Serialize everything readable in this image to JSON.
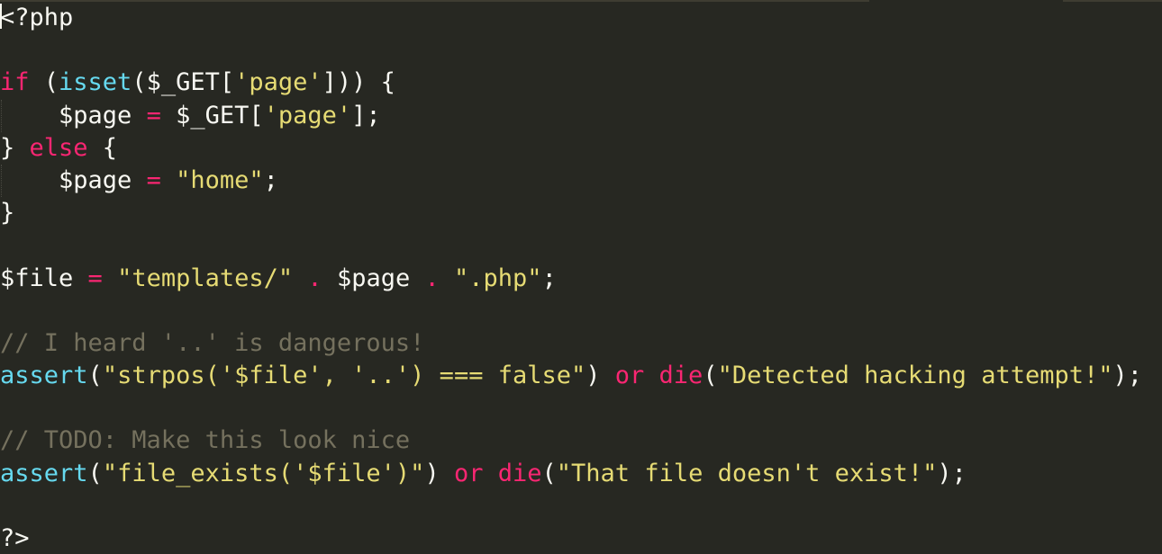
{
  "editor": {
    "language": "php",
    "theme_colors": {
      "background": "#272822",
      "keyword": "#f92672",
      "function": "#66d9ef",
      "string": "#e6db74",
      "comment": "#75715e",
      "text": "#f8f8f2"
    },
    "lines": [
      {
        "tokens": [
          {
            "t": "pl",
            "v": "<?php"
          }
        ]
      },
      {
        "tokens": []
      },
      {
        "tokens": [
          {
            "t": "kw",
            "v": "if"
          },
          {
            "t": "pl",
            "v": " ("
          },
          {
            "t": "fn",
            "v": "isset"
          },
          {
            "t": "pl",
            "v": "($_GET["
          },
          {
            "t": "str",
            "v": "'page'"
          },
          {
            "t": "pl",
            "v": "])) {"
          }
        ]
      },
      {
        "indent": true,
        "tokens": [
          {
            "t": "pl",
            "v": "    $page "
          },
          {
            "t": "op",
            "v": "="
          },
          {
            "t": "pl",
            "v": " $_GET["
          },
          {
            "t": "str",
            "v": "'page'"
          },
          {
            "t": "pl",
            "v": "];"
          }
        ]
      },
      {
        "tokens": [
          {
            "t": "pl",
            "v": "} "
          },
          {
            "t": "kw",
            "v": "else"
          },
          {
            "t": "pl",
            "v": " {"
          }
        ]
      },
      {
        "indent": true,
        "tokens": [
          {
            "t": "pl",
            "v": "    $page "
          },
          {
            "t": "op",
            "v": "="
          },
          {
            "t": "pl",
            "v": " "
          },
          {
            "t": "str",
            "v": "\"home\""
          },
          {
            "t": "pl",
            "v": ";"
          }
        ]
      },
      {
        "tokens": [
          {
            "t": "pl",
            "v": "}"
          }
        ]
      },
      {
        "tokens": []
      },
      {
        "tokens": [
          {
            "t": "pl",
            "v": "$file "
          },
          {
            "t": "op",
            "v": "="
          },
          {
            "t": "pl",
            "v": " "
          },
          {
            "t": "str",
            "v": "\"templates/\""
          },
          {
            "t": "pl",
            "v": " "
          },
          {
            "t": "op",
            "v": "."
          },
          {
            "t": "pl",
            "v": " $page "
          },
          {
            "t": "op",
            "v": "."
          },
          {
            "t": "pl",
            "v": " "
          },
          {
            "t": "str",
            "v": "\".php\""
          },
          {
            "t": "pl",
            "v": ";"
          }
        ]
      },
      {
        "tokens": []
      },
      {
        "tokens": [
          {
            "t": "cm",
            "v": "// I heard '..' is dangerous!"
          }
        ]
      },
      {
        "tokens": [
          {
            "t": "fn",
            "v": "assert"
          },
          {
            "t": "pl",
            "v": "("
          },
          {
            "t": "str",
            "v": "\"strpos('$file', '..') === false\""
          },
          {
            "t": "pl",
            "v": ") "
          },
          {
            "t": "kw",
            "v": "or"
          },
          {
            "t": "pl",
            "v": " "
          },
          {
            "t": "kw",
            "v": "die"
          },
          {
            "t": "pl",
            "v": "("
          },
          {
            "t": "str",
            "v": "\"Detected hacking attempt!\""
          },
          {
            "t": "pl",
            "v": ");"
          }
        ]
      },
      {
        "tokens": []
      },
      {
        "tokens": [
          {
            "t": "cm",
            "v": "// TODO: Make this look nice"
          }
        ]
      },
      {
        "tokens": [
          {
            "t": "fn",
            "v": "assert"
          },
          {
            "t": "pl",
            "v": "("
          },
          {
            "t": "str",
            "v": "\"file_exists('$file')\""
          },
          {
            "t": "pl",
            "v": ") "
          },
          {
            "t": "kw",
            "v": "or"
          },
          {
            "t": "pl",
            "v": " "
          },
          {
            "t": "kw",
            "v": "die"
          },
          {
            "t": "pl",
            "v": "("
          },
          {
            "t": "str",
            "v": "\"That file doesn't exist!\""
          },
          {
            "t": "pl",
            "v": ");"
          }
        ]
      },
      {
        "tokens": []
      },
      {
        "tokens": [
          {
            "t": "pl",
            "v": "?>"
          }
        ]
      }
    ]
  }
}
